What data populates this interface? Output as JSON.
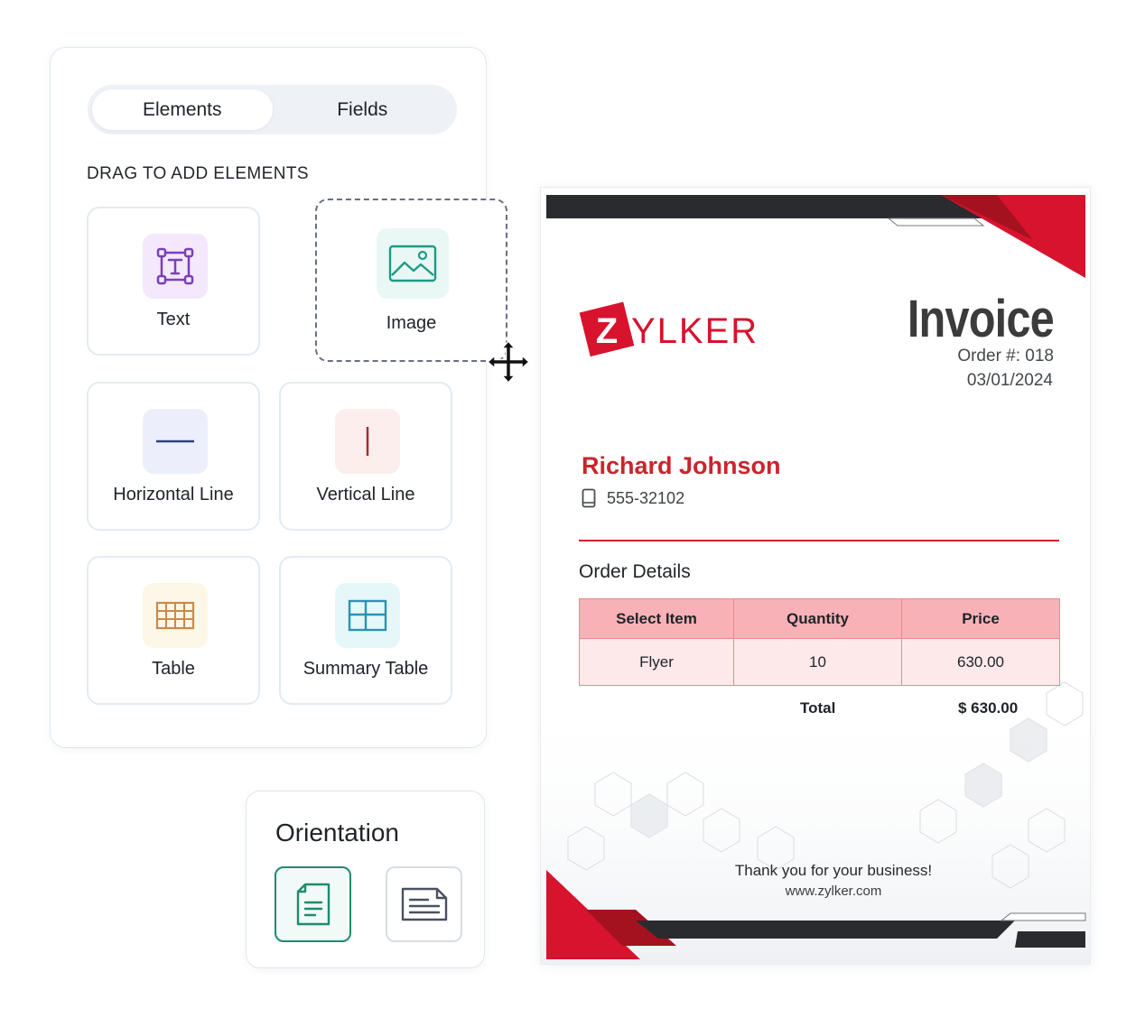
{
  "tabs": [
    {
      "label": "Elements",
      "active": true
    },
    {
      "label": "Fields",
      "active": false
    }
  ],
  "panel_heading": "DRAG TO ADD ELEMENTS",
  "elements": {
    "text": {
      "label": "Text",
      "icon": "text-box-icon"
    },
    "image": {
      "label": "Image",
      "icon": "image-icon"
    },
    "horizontal_line": {
      "label": "Horizontal Line",
      "icon": "horizontal-line-icon"
    },
    "vertical_line": {
      "label": "Vertical Line",
      "icon": "vertical-line-icon"
    },
    "table": {
      "label": "Table",
      "icon": "table-grid-icon"
    },
    "summary_table": {
      "label": "Summary Table",
      "icon": "summary-table-icon"
    }
  },
  "orientation": {
    "title": "Orientation",
    "options": [
      {
        "name": "portrait",
        "selected": true,
        "icon": "portrait-document-icon"
      },
      {
        "name": "landscape",
        "selected": false,
        "icon": "landscape-document-icon"
      }
    ]
  },
  "invoice": {
    "brand_initial": "Z",
    "brand_rest": "YLKER",
    "title": "Invoice",
    "order": "Order #: 018",
    "date": "03/01/2024",
    "customer_name": "Richard Johnson",
    "customer_phone": "555-32102",
    "order_details_title": "Order Details",
    "table": {
      "headers": [
        "Select Item",
        "Quantity",
        "Price"
      ],
      "rows": [
        [
          "Flyer",
          "10",
          "630.00"
        ]
      ]
    },
    "total_label": "Total",
    "total_value": "$ 630.00",
    "thanks": "Thank you for your business!",
    "website": "www.zylker.com"
  },
  "colors": {
    "accent_green": "#1f8a6e",
    "brand_red": "#d7132e",
    "dark_band": "#2a2b2f",
    "table_header": "#f8b2b7",
    "table_row": "#fde8ea"
  }
}
